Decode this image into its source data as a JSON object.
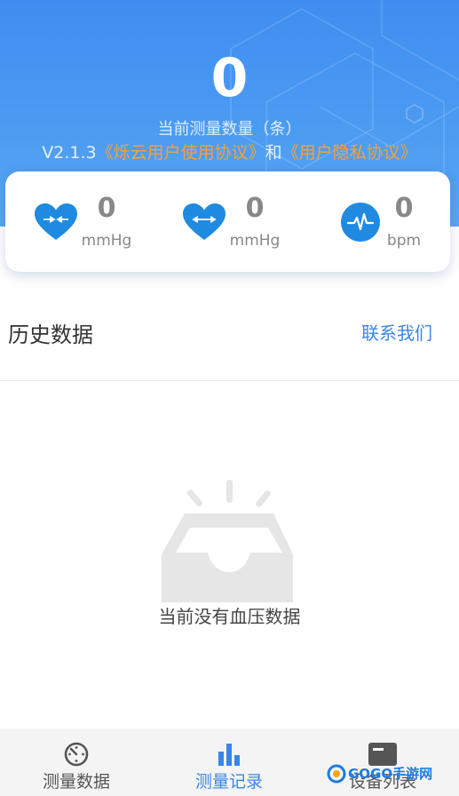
{
  "header": {
    "count": "0",
    "count_label": "当前测量数量（条）",
    "version": "V2.1.3",
    "user_agreement": "《烁云用户使用协议》",
    "and_text": "和",
    "privacy_policy": "《用户隐私协议》"
  },
  "metrics": [
    {
      "icon": "heart-compress-icon",
      "value": "0",
      "unit": "mmHg"
    },
    {
      "icon": "heart-expand-icon",
      "value": "0",
      "unit": "mmHg"
    },
    {
      "icon": "pulse-icon",
      "value": "0",
      "unit": "bpm"
    }
  ],
  "history": {
    "title": "历史数据",
    "contact": "联系我们",
    "empty_text": "当前没有血压数据"
  },
  "tabs": [
    {
      "label": "测量数据",
      "icon": "dial-icon",
      "active": false
    },
    {
      "label": "测量记录",
      "icon": "bar-chart-icon",
      "active": true
    },
    {
      "label": "设备列表",
      "icon": "device-icon",
      "active": false
    }
  ],
  "watermark": {
    "text": "GOGO手游网"
  },
  "colors": {
    "primary": "#3a86e8",
    "hero_blue": "#4c9cf2",
    "icon_blue": "#1f8ae0",
    "link_orange": "#f6a03a",
    "muted": "#888888"
  }
}
